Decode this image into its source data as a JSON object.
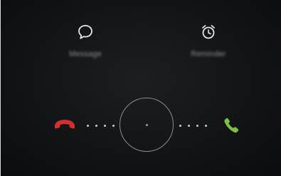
{
  "quick_actions": {
    "message": {
      "label": "Message",
      "icon": "message-bubble-icon"
    },
    "reminder": {
      "label": "Reminder",
      "icon": "alarm-clock-icon"
    }
  },
  "call_controls": {
    "decline_icon": "phone-hangup-icon",
    "accept_icon": "phone-answer-icon",
    "colors": {
      "decline": "#d32f2f",
      "accept": "#7cc242",
      "ring": "#8a8c8e"
    }
  }
}
